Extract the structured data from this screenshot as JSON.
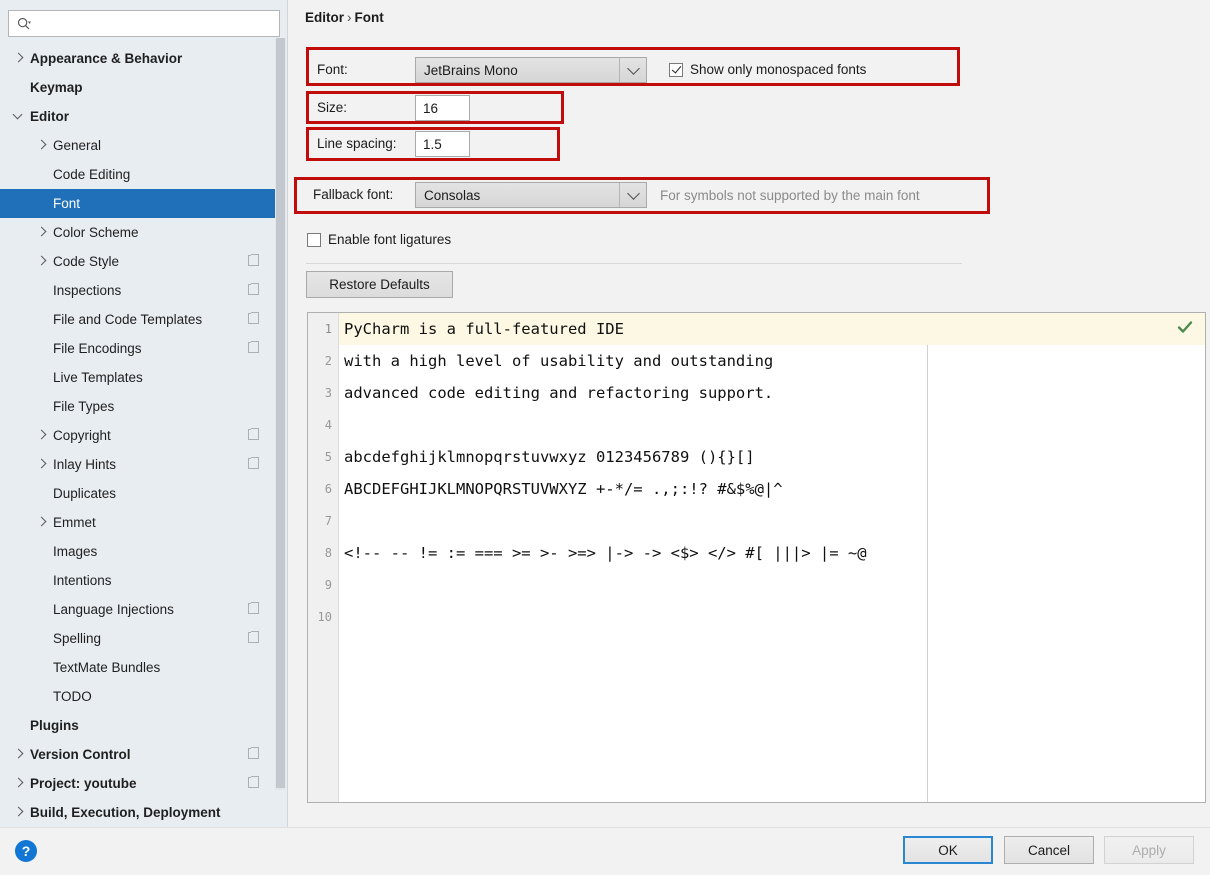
{
  "search": {
    "placeholder": "",
    "value": "",
    "icon": "search-icon"
  },
  "sidebar": {
    "items": [
      {
        "label": "Appearance & Behavior",
        "indent": 0,
        "arrow": "right",
        "bold": true,
        "badge": false,
        "selected": false
      },
      {
        "label": "Keymap",
        "indent": 0,
        "arrow": "none",
        "bold": true,
        "badge": false,
        "selected": false
      },
      {
        "label": "Editor",
        "indent": 0,
        "arrow": "down",
        "bold": true,
        "badge": false,
        "selected": false
      },
      {
        "label": "General",
        "indent": 1,
        "arrow": "right",
        "bold": false,
        "badge": false,
        "selected": false
      },
      {
        "label": "Code Editing",
        "indent": 1,
        "arrow": "none",
        "bold": false,
        "badge": false,
        "selected": false
      },
      {
        "label": "Font",
        "indent": 1,
        "arrow": "none",
        "bold": false,
        "badge": false,
        "selected": true
      },
      {
        "label": "Color Scheme",
        "indent": 1,
        "arrow": "right",
        "bold": false,
        "badge": false,
        "selected": false
      },
      {
        "label": "Code Style",
        "indent": 1,
        "arrow": "right",
        "bold": false,
        "badge": true,
        "selected": false
      },
      {
        "label": "Inspections",
        "indent": 1,
        "arrow": "none",
        "bold": false,
        "badge": true,
        "selected": false
      },
      {
        "label": "File and Code Templates",
        "indent": 1,
        "arrow": "none",
        "bold": false,
        "badge": true,
        "selected": false
      },
      {
        "label": "File Encodings",
        "indent": 1,
        "arrow": "none",
        "bold": false,
        "badge": true,
        "selected": false
      },
      {
        "label": "Live Templates",
        "indent": 1,
        "arrow": "none",
        "bold": false,
        "badge": false,
        "selected": false
      },
      {
        "label": "File Types",
        "indent": 1,
        "arrow": "none",
        "bold": false,
        "badge": false,
        "selected": false
      },
      {
        "label": "Copyright",
        "indent": 1,
        "arrow": "right",
        "bold": false,
        "badge": true,
        "selected": false
      },
      {
        "label": "Inlay Hints",
        "indent": 1,
        "arrow": "right",
        "bold": false,
        "badge": true,
        "selected": false
      },
      {
        "label": "Duplicates",
        "indent": 1,
        "arrow": "none",
        "bold": false,
        "badge": false,
        "selected": false
      },
      {
        "label": "Emmet",
        "indent": 1,
        "arrow": "right",
        "bold": false,
        "badge": false,
        "selected": false
      },
      {
        "label": "Images",
        "indent": 1,
        "arrow": "none",
        "bold": false,
        "badge": false,
        "selected": false
      },
      {
        "label": "Intentions",
        "indent": 1,
        "arrow": "none",
        "bold": false,
        "badge": false,
        "selected": false
      },
      {
        "label": "Language Injections",
        "indent": 1,
        "arrow": "none",
        "bold": false,
        "badge": true,
        "selected": false
      },
      {
        "label": "Spelling",
        "indent": 1,
        "arrow": "none",
        "bold": false,
        "badge": true,
        "selected": false
      },
      {
        "label": "TextMate Bundles",
        "indent": 1,
        "arrow": "none",
        "bold": false,
        "badge": false,
        "selected": false
      },
      {
        "label": "TODO",
        "indent": 1,
        "arrow": "none",
        "bold": false,
        "badge": false,
        "selected": false
      },
      {
        "label": "Plugins",
        "indent": 0,
        "arrow": "none",
        "bold": true,
        "badge": false,
        "selected": false
      },
      {
        "label": "Version Control",
        "indent": 0,
        "arrow": "right",
        "bold": true,
        "badge": true,
        "selected": false
      },
      {
        "label": "Project: youtube",
        "indent": 0,
        "arrow": "right",
        "bold": true,
        "badge": true,
        "selected": false
      },
      {
        "label": "Build, Execution, Deployment",
        "indent": 0,
        "arrow": "right",
        "bold": true,
        "badge": false,
        "selected": false
      }
    ]
  },
  "breadcrumb": {
    "parent": "Editor",
    "separator": "›",
    "current": "Font"
  },
  "settings": {
    "font_label": "Font:",
    "font_value": "JetBrains Mono",
    "monospaced_label": "Show only monospaced fonts",
    "monospaced_checked": true,
    "size_label": "Size:",
    "size_value": "16",
    "line_spacing_label": "Line spacing:",
    "line_spacing_value": "1.5",
    "fallback_label": "Fallback font:",
    "fallback_value": "Consolas",
    "fallback_hint": "For symbols not supported by the main font",
    "ligatures_label": "Enable font ligatures",
    "ligatures_checked": false,
    "restore_defaults_label": "Restore Defaults",
    "highlight_color": "#c10c0c"
  },
  "preview": {
    "lines": [
      {
        "num": "1",
        "text": "PyCharm is a full-featured IDE"
      },
      {
        "num": "2",
        "text": "with a high level of usability and outstanding"
      },
      {
        "num": "3",
        "text": "advanced code editing and refactoring support."
      },
      {
        "num": "4",
        "text": ""
      },
      {
        "num": "5",
        "text": "abcdefghijklmnopqrstuvwxyz 0123456789 (){}[]"
      },
      {
        "num": "6",
        "text": "ABCDEFGHIJKLMNOPQRSTUVWXYZ +-*/= .,;:!? #&$%@|^"
      },
      {
        "num": "7",
        "text": ""
      },
      {
        "num": "8",
        "text": "<!-- -- != := === >= >- >=> |-> -> <$> </> #[ |||> |= ~@"
      },
      {
        "num": "9",
        "text": ""
      },
      {
        "num": "10",
        "text": ""
      }
    ],
    "status_icon": "green-check-icon"
  },
  "footer": {
    "help_icon": "?",
    "ok_label": "OK",
    "cancel_label": "Cancel",
    "apply_label": "Apply"
  }
}
